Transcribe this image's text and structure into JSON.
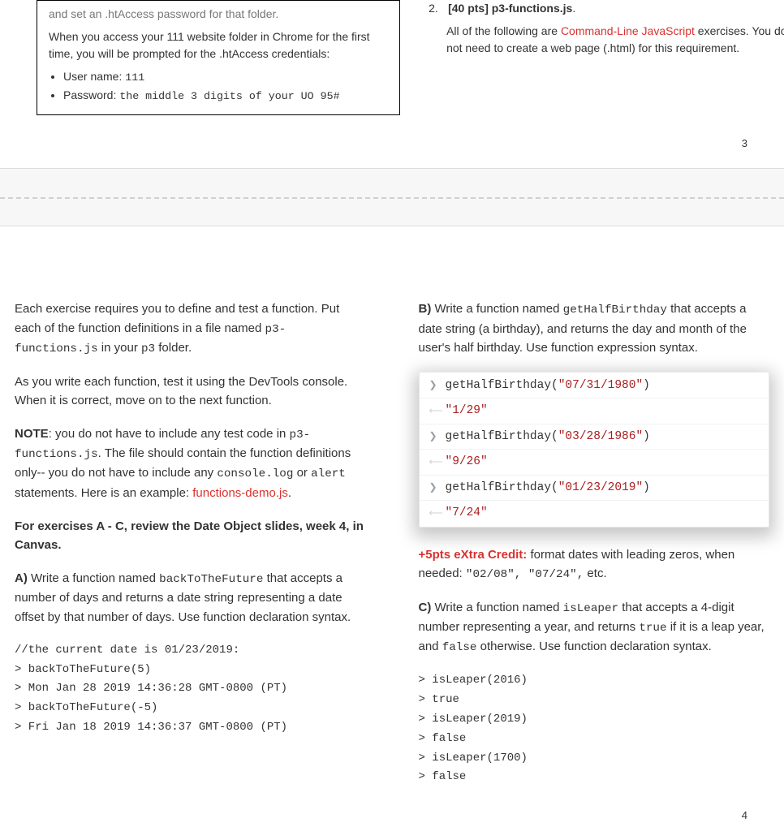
{
  "page3": {
    "left": {
      "cutoff_line": "and set an .htAccess password for that folder.",
      "access_sentence": "When you access your 111 website folder in Chrome for the first time, you will be prompted for the .htAccess credentials:",
      "user_label": "User name: ",
      "user_value": "111",
      "pass_label": "Password: ",
      "pass_value": "the middle 3 digits of your UO 95#"
    },
    "right": {
      "heading_num": "2.",
      "heading_bold": "[40 pts] p3-functions.js",
      "cmdline_pre": "All of the following are ",
      "cmdline_link": "Command-Line JavaScript",
      "cmdline_post": " exercises. You do not need to create a web page (.html) for this requirement."
    },
    "pagenum": "3"
  },
  "page4": {
    "left": {
      "p1_a": "Each exercise requires you to define and test a function. Put each of the function definitions in a file named ",
      "p1_code1": "p3-functions.js",
      "p1_b": " in your ",
      "p1_code2": "p3",
      "p1_c": " folder.",
      "p2": "As you write each function, test it using the DevTools console. When it is correct, move on to the next function.",
      "p3_a": "NOTE",
      "p3_b": ": you do not have to include any test code in ",
      "p3_code1": "p3-functions.js",
      "p3_c": ". The file should contain the function definitions only-- you do not have to include any ",
      "p3_code2": "console.log",
      "p3_d": " or ",
      "p3_code3": "alert",
      "p3_e": " statements. Here is an example: ",
      "p3_link": "functions-demo.js",
      "p3_f": ".",
      "p4": "For exercises A - C, review the Date Object slides, week 4, in Canvas.",
      "pA_a": "A)",
      "pA_b": " Write a function named ",
      "pA_code": "backToTheFuture",
      "pA_c": " that accepts a number of days and returns a date string representing a date offset by that number of days. Use function declaration syntax.",
      "codeA": "//the current date is 01/23/2019:\n> backToTheFuture(5)\n> Mon Jan 28 2019 14:36:28 GMT-0800 (PT)\n> backToTheFuture(-5)\n> Fri Jan 18 2019 14:36:37 GMT-0800 (PT)"
    },
    "right": {
      "pB_a": "B)",
      "pB_b": " Write a function named ",
      "pB_code": "getHalfBirthday",
      "pB_c": " that accepts a date string (a birthday), and returns the day and month of the user's half birthday. Use function expression syntax.",
      "console": [
        {
          "type": "in",
          "fn": "getHalfBirthday(",
          "arg": "\"07/31/1980\"",
          "close": ")"
        },
        {
          "type": "out",
          "value": "\"1/29\""
        },
        {
          "type": "in",
          "fn": "getHalfBirthday(",
          "arg": "\"03/28/1986\"",
          "close": ")"
        },
        {
          "type": "out",
          "value": "\"9/26\""
        },
        {
          "type": "in",
          "fn": "getHalfBirthday(",
          "arg": "\"01/23/2019\"",
          "close": ")"
        },
        {
          "type": "out",
          "value": "\"7/24\""
        }
      ],
      "pXC_a": "+5pts eXtra Credit:",
      "pXC_b": " format dates with leading zeros, when needed: ",
      "pXC_code": "\"02/08\", \"07/24\",",
      "pXC_c": " etc.",
      "pC_a": "C)",
      "pC_b": " Write a function named ",
      "pC_code": "isLeaper",
      "pC_c": " that accepts a 4-digit number representing a year, and returns ",
      "pC_code2": "true",
      "pC_d": " if it is a leap year, and ",
      "pC_code3": "false",
      "pC_e": " otherwise. Use function declaration syntax.",
      "codeC": "> isLeaper(2016)\n> true\n> isLeaper(2019)\n> false\n> isLeaper(1700)\n> false"
    },
    "pagenum": "4"
  }
}
